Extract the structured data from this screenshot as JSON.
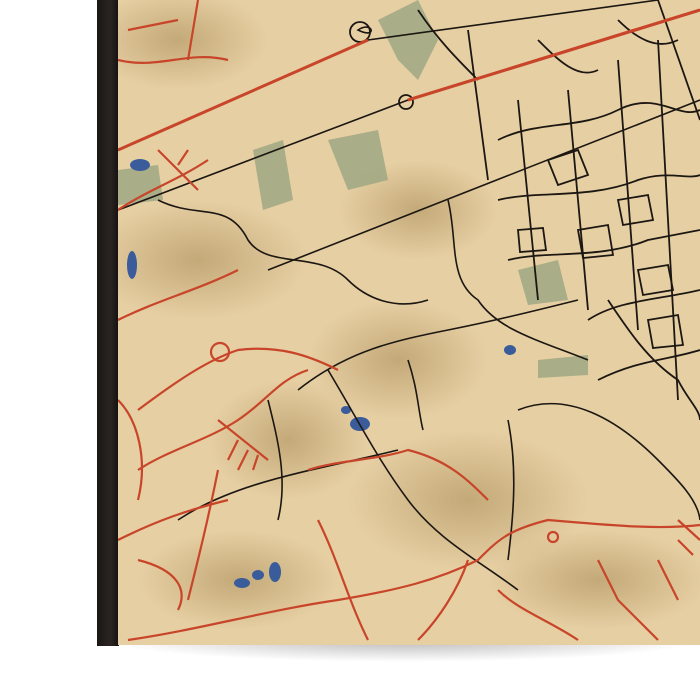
{
  "artwork": {
    "type": "framed map canvas print",
    "colors": {
      "paper": "#e6cfa3",
      "stain": "#b89a62",
      "major_road": "#c8452a",
      "minor_road": "#1c1712",
      "water": "#3a5c9a",
      "park": "#9aa582",
      "frame": "#1e1a18"
    }
  }
}
